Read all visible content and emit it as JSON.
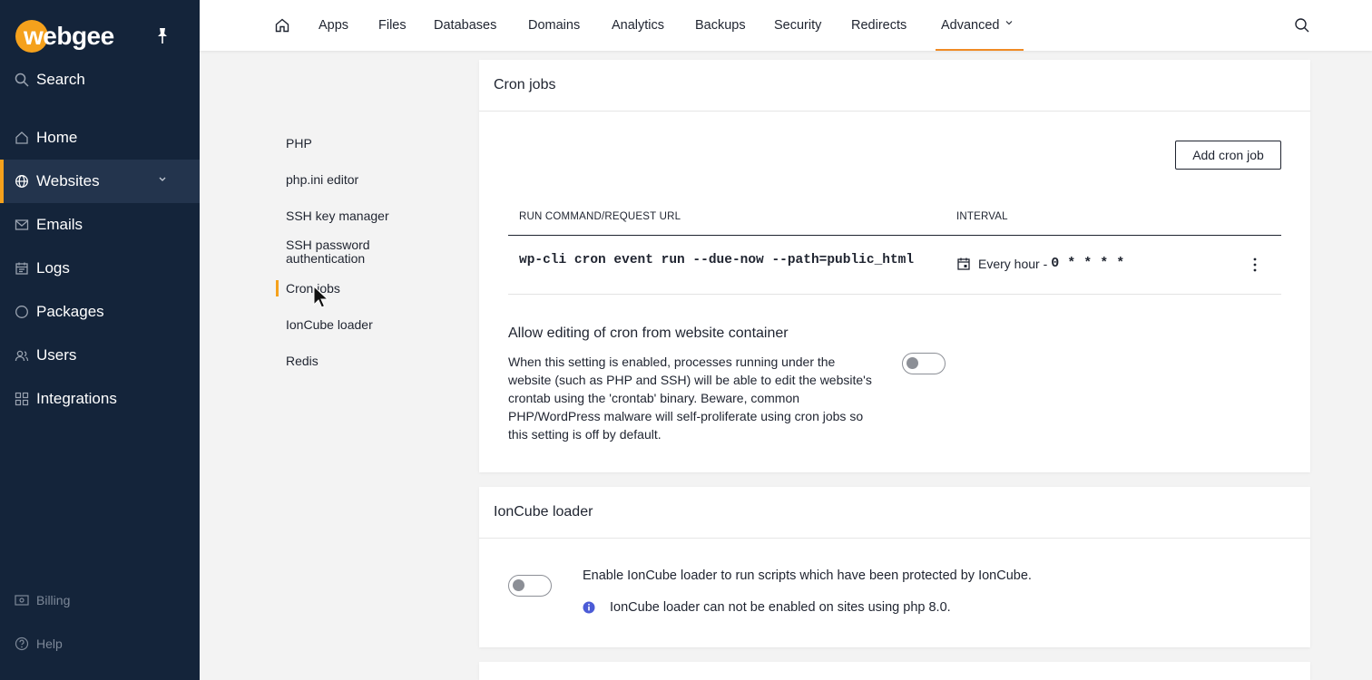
{
  "brand": {
    "name": "webgee",
    "accent": "#f5a11c",
    "sidebar_bg": "#14243a"
  },
  "sidebar": {
    "search_label": "Search",
    "items": [
      {
        "label": "Home",
        "icon": "home-icon"
      },
      {
        "label": "Websites",
        "icon": "globe-icon",
        "active": true
      },
      {
        "label": "Emails",
        "icon": "mail-icon"
      },
      {
        "label": "Logs",
        "icon": "logs-icon"
      },
      {
        "label": "Packages",
        "icon": "packages-icon"
      },
      {
        "label": "Users",
        "icon": "users-icon"
      },
      {
        "label": "Integrations",
        "icon": "grid-icon"
      }
    ],
    "bottom": [
      {
        "label": "Billing",
        "icon": "billing-icon"
      },
      {
        "label": "Help",
        "icon": "help-icon"
      }
    ]
  },
  "topnav": {
    "items": [
      "Apps",
      "Files",
      "Databases",
      "Domains",
      "Analytics",
      "Backups",
      "Security",
      "Redirects",
      "Advanced"
    ],
    "active": "Advanced"
  },
  "subnav": {
    "items": [
      "PHP",
      "php.ini editor",
      "SSH key manager",
      "SSH password authentication",
      "Cron jobs",
      "IonCube loader",
      "Redis"
    ],
    "active": "Cron jobs"
  },
  "cron": {
    "title": "Cron jobs",
    "add_button": "Add cron job",
    "col_command": "RUN COMMAND/REQUEST URL",
    "col_interval": "INTERVAL",
    "job": {
      "command": "wp-cli cron event run --due-now --path=public_html",
      "interval_label": "Every hour -",
      "interval_expr": "0 * * * *"
    },
    "setting_title": "Allow editing of cron from website container",
    "setting_desc": "When this setting is enabled, processes running under the website (such as PHP and SSH) will be able to edit the website's crontab using the 'crontab' binary. Beware, common PHP/WordPress malware will self-proliferate using cron jobs so this setting is off by default.",
    "setting_enabled": false
  },
  "ioncube": {
    "title": "IonCube loader",
    "enable_text": "Enable IonCube loader to run scripts which have been protected by IonCube.",
    "note": "IonCube loader can not be enabled on sites using php 8.0.",
    "enabled": false
  }
}
